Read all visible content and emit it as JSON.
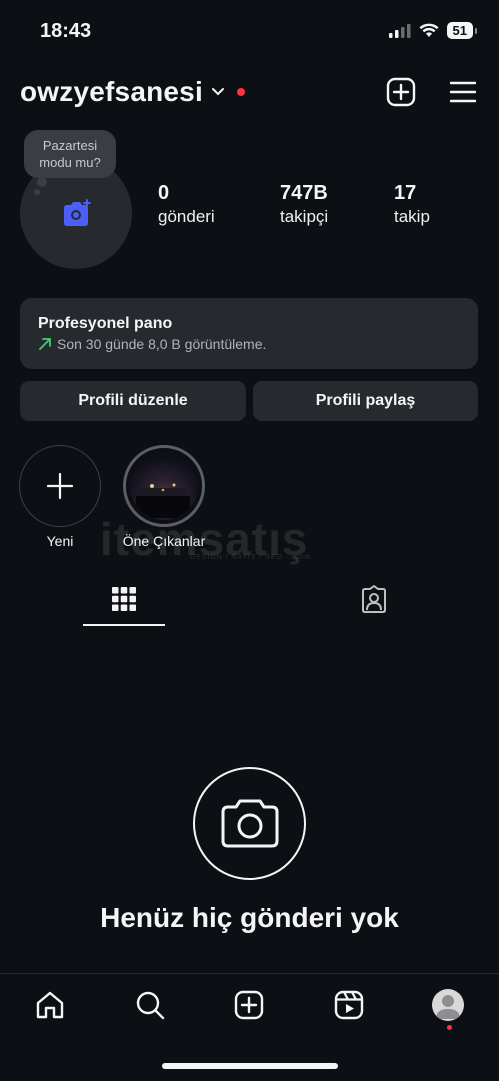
{
  "status_bar": {
    "time": "18:43",
    "battery": "51"
  },
  "header": {
    "username": "owzyefsanesi"
  },
  "note_bubble": {
    "line1": "Pazartesi",
    "line2": "modu mu?"
  },
  "stats": [
    {
      "value": "0",
      "label": "gönderi"
    },
    {
      "value": "747B",
      "label": "takipçi"
    },
    {
      "value": "17",
      "label": "takip"
    }
  ],
  "pro_dashboard": {
    "title": "Profesyonel pano",
    "subtitle": "Son 30 günde 8,0 B görüntüleme."
  },
  "buttons": {
    "edit_profile": "Profili düzenle",
    "share_profile": "Profili paylaş"
  },
  "highlights": [
    {
      "label": "Yeni"
    },
    {
      "label": "Öne Çıkanlar"
    }
  ],
  "watermark": {
    "text": "itemsatış",
    "sub": "DESIGN / SATIŞ / SEO · .com"
  },
  "empty_state": {
    "text": "Henüz hiç gönderi yok"
  },
  "colors": {
    "background": "#0c1014",
    "surface": "#262a2f",
    "accent_blue": "#4a5ff5",
    "notification_red": "#ff3040",
    "trend_green": "#3ccf6e"
  }
}
